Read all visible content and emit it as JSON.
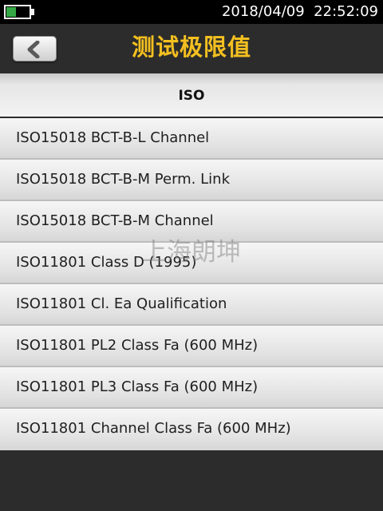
{
  "status_bar": {
    "battery_level": 0.45,
    "battery_color": "#35a845",
    "datetime": "2018/04/09  22:52:09"
  },
  "header": {
    "back_icon": "chevron-left-icon",
    "title": "测试极限值",
    "title_color": "#f4c020"
  },
  "list": {
    "header": "ISO",
    "items": [
      "ISO15018 BCT-B-L Channel",
      "ISO15018 BCT-B-M Perm. Link",
      "ISO15018 BCT-B-M Channel",
      "ISO11801 Class D (1995)",
      "ISO11801 Cl. Ea Qualification",
      "ISO11801 PL2 Class Fa (600 MHz)",
      "ISO11801 PL3 Class Fa (600 MHz)",
      "ISO11801 Channel Class Fa (600 MHz)"
    ]
  },
  "watermark": "上海朗坤"
}
